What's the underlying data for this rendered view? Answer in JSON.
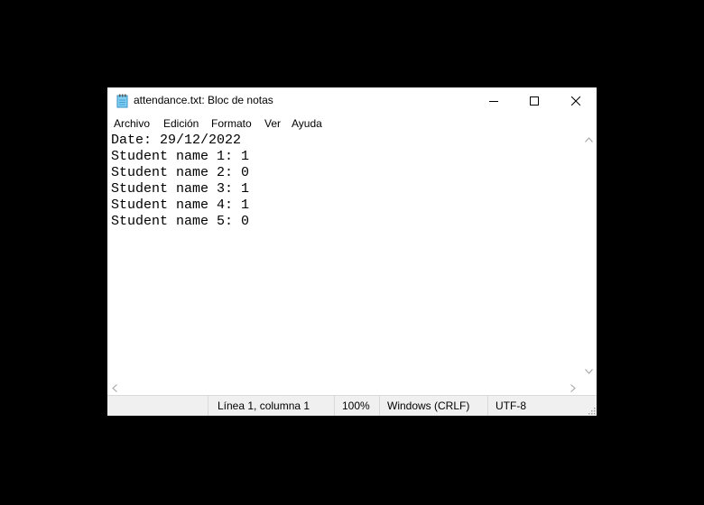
{
  "window": {
    "title": "attendance.txt: Bloc de notas",
    "app_icon": "notepad-icon",
    "controls": [
      "minimize-icon",
      "maximize-icon",
      "close-icon"
    ]
  },
  "menu": {
    "items": [
      {
        "label": "Archivo"
      },
      {
        "label": "Edición"
      },
      {
        "label": "Formato"
      },
      {
        "label": "Ver"
      },
      {
        "label": "Ayuda"
      }
    ]
  },
  "editor": {
    "lines": [
      "Date: 29/12/2022",
      "Student name 1: 1",
      "Student name 2: 0",
      "Student name 3: 1",
      "Student name 4: 1",
      "Student name 5: 0"
    ]
  },
  "status": {
    "position": "Línea 1, columna 1",
    "zoom": "100%",
    "line_ending": "Windows (CRLF)",
    "encoding": "UTF-8"
  },
  "colors": {
    "desktop": "#000000",
    "window_bg": "#ffffff",
    "status_bg": "#f0f0f0",
    "scroll_arrow": "#a0a0a0"
  }
}
